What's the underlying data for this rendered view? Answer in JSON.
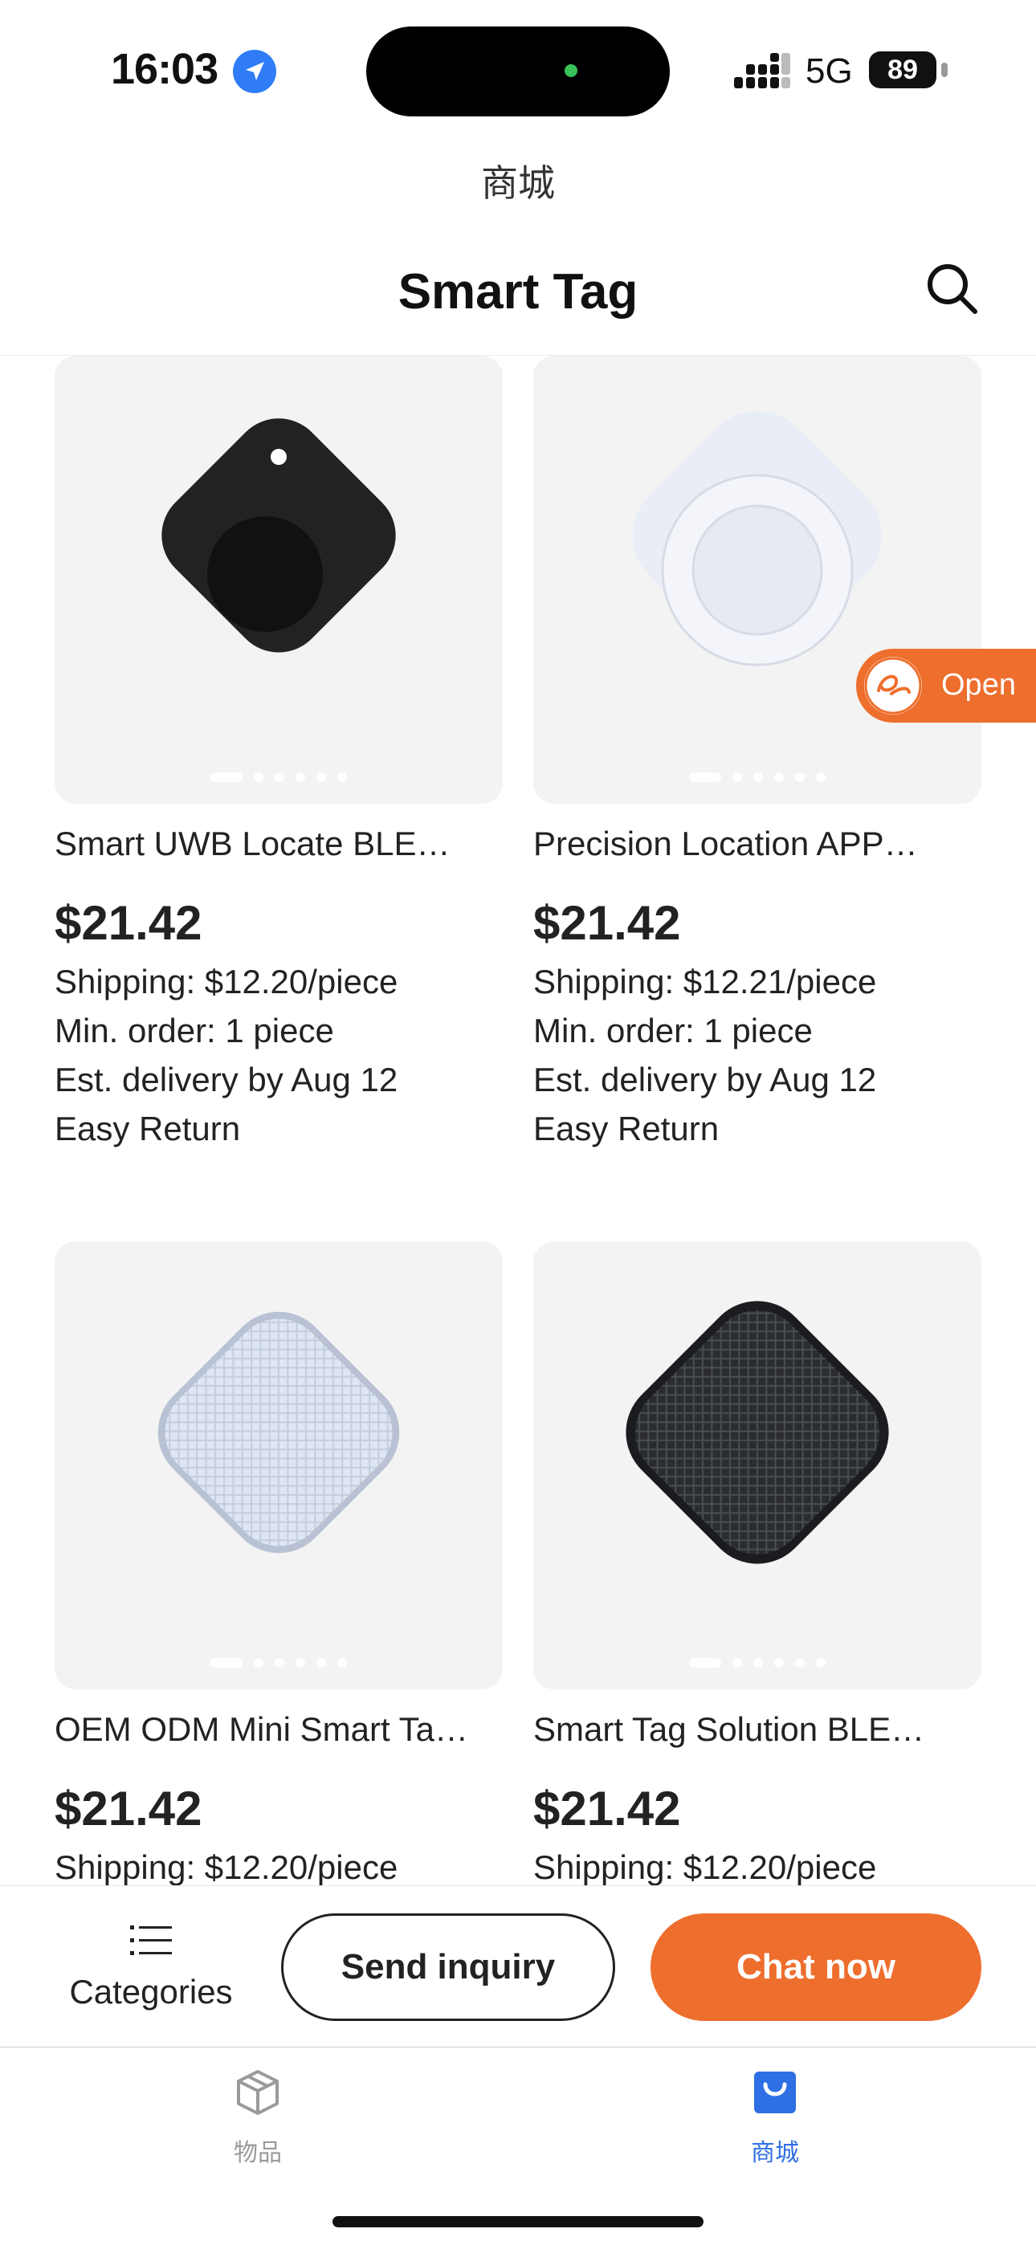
{
  "status_bar": {
    "time": "16:03",
    "network": "5G",
    "battery": "89"
  },
  "header": {
    "mall_title": "商城",
    "page_title": "Smart Tag"
  },
  "products": [
    {
      "title": "Smart UWB Locate BLE…",
      "price": "$21.42",
      "shipping": "Shipping: $12.20/piece",
      "min_order": "Min. order: 1 piece",
      "delivery": "Est. delivery by Aug 12",
      "returns": "Easy Return",
      "image_pages": 6
    },
    {
      "title": "Precision Location APP…",
      "price": "$21.42",
      "shipping": "Shipping: $12.21/piece",
      "min_order": "Min. order: 1 piece",
      "delivery": "Est. delivery by Aug 12",
      "returns": "Easy Return",
      "image_pages": 6
    },
    {
      "title": "OEM ODM Mini Smart Ta…",
      "price": "$21.42",
      "shipping": "Shipping: $12.20/piece",
      "image_pages": 6
    },
    {
      "title": "Smart Tag Solution BLE…",
      "price": "$21.42",
      "shipping": "Shipping: $12.20/piece",
      "image_pages": 6
    }
  ],
  "open_badge": {
    "label": "Open"
  },
  "action_bar": {
    "categories_label": "Categories",
    "inquiry_label": "Send inquiry",
    "chat_label": "Chat now"
  },
  "tab_bar": {
    "items": [
      {
        "label": "物品",
        "icon": "box-icon",
        "active": false
      },
      {
        "label": "商城",
        "icon": "shopping-bag-icon",
        "active": true
      }
    ]
  },
  "colors": {
    "accent": "#ee6e2d",
    "tab_active": "#2f6fe4",
    "tab_inactive": "#9a9a9a"
  }
}
